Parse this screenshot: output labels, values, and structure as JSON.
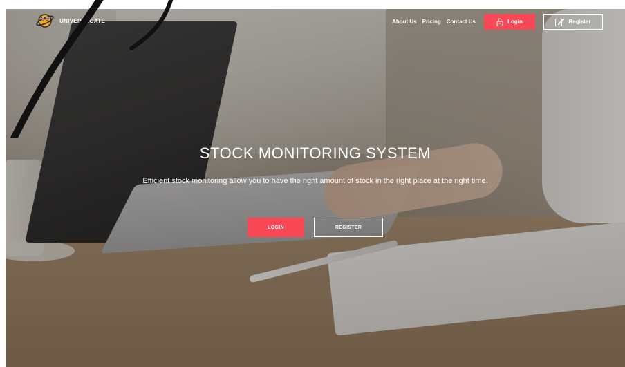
{
  "brand": {
    "name": "UNIVERSEGATE"
  },
  "nav": {
    "links": [
      "About Us",
      "Pricing",
      "Contact Us"
    ],
    "login_label": "Login",
    "register_label": "Register"
  },
  "hero": {
    "title": "STOCK MONITORING SYSTEM",
    "subtitle": "Efficient stock monitoring allow you to have the right amount of stock in the right place at the right time.",
    "login_label": "LOGIN",
    "register_label": "REGISTER"
  },
  "colors": {
    "accent": "#f84855",
    "text": "#ffffff"
  },
  "icons": {
    "brand": "planet-logo-icon",
    "login": "lock-icon",
    "register": "edit-icon"
  }
}
